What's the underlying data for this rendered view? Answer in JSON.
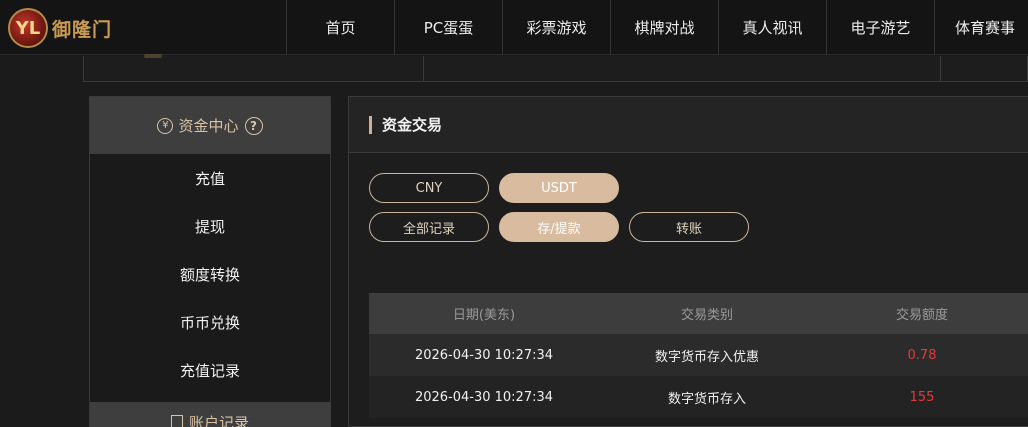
{
  "brand": {
    "name": "御隆门",
    "mark": "YL"
  },
  "nav": {
    "items": [
      "首页",
      "PC蛋蛋",
      "彩票游戏",
      "棋牌对战",
      "真人视讯",
      "电子游艺",
      "体育赛事"
    ]
  },
  "sidebar": {
    "section1_title": "资金中心",
    "section1_icon_glyph": "¥",
    "help_glyph": "?",
    "items": [
      "充值",
      "提现",
      "额度转换",
      "币币兑换",
      "充值记录"
    ],
    "section2_title": "账户记录"
  },
  "panel": {
    "title": "资金交易",
    "currency_tabs": [
      {
        "label": "CNY",
        "active": false
      },
      {
        "label": "USDT",
        "active": true
      }
    ],
    "record_tabs": [
      {
        "label": "全部记录",
        "active": false
      },
      {
        "label": "存/提款",
        "active": true
      },
      {
        "label": "转账",
        "active": false
      }
    ],
    "table": {
      "headers": [
        "日期(美东)",
        "交易类别",
        "交易额度"
      ],
      "rows": [
        {
          "date": "2026-04-30 10:27:34",
          "type": "数字货币存入优惠",
          "amount": "0.78"
        },
        {
          "date": "2026-04-30 10:27:34",
          "type": "数字货币存入",
          "amount": "155"
        }
      ]
    }
  },
  "colors": {
    "accent": "#d9bca0",
    "amount": "#e23b3b",
    "gold": "#c89a52"
  }
}
